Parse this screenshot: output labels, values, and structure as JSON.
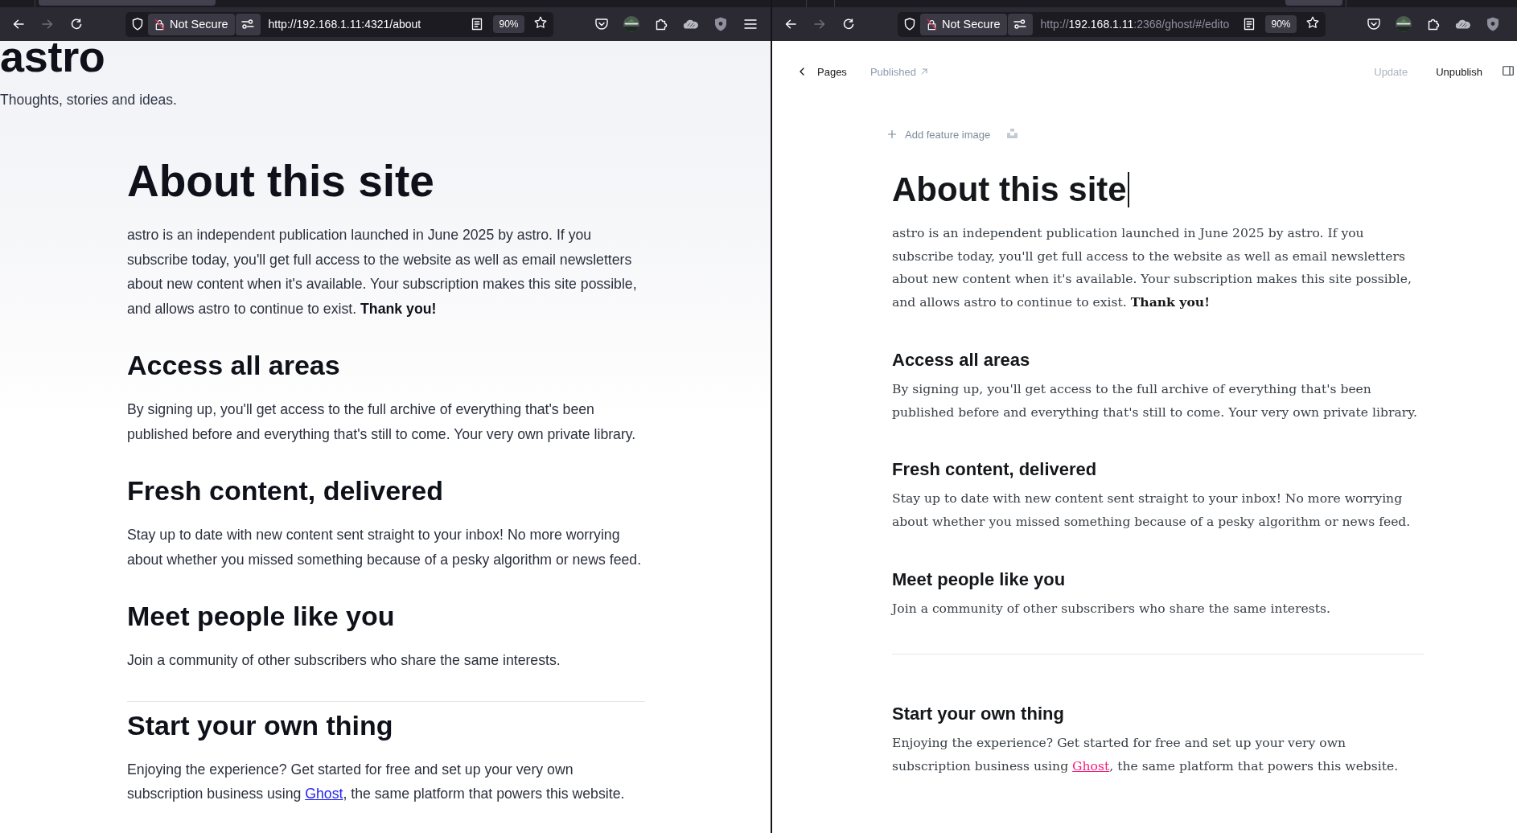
{
  "site_window": {
    "toolbar": {
      "back": {
        "disabled": false
      },
      "forward": {
        "disabled": true
      },
      "security_label": "Not Secure",
      "url": [
        {
          "text": "http://192.168.1.11:4321/about",
          "dim": false
        }
      ],
      "zoom": "90%",
      "menu": true
    },
    "site_title": "astro",
    "tagline": "Thoughts, stories and ideas.",
    "article": {
      "title": "About this site",
      "blocks": [
        {
          "kind": "paragraph",
          "parts": [
            {
              "text": "astro is an independent publication launched in June 2025 by astro. If you subscribe today, you'll get full access to the website as well as email newsletters about new content when it's available. Your subscription makes this site possible, and allows astro to continue to exist. **Thank you!**",
              "link": false
            }
          ]
        },
        {
          "kind": "heading",
          "text": "Access all areas"
        },
        {
          "kind": "paragraph",
          "parts": [
            {
              "text": "By signing up, you'll get access to the full archive of everything that's been published before and everything that's still to come. Your very own private library.",
              "link": false
            }
          ]
        },
        {
          "kind": "heading",
          "text": "Fresh content, delivered"
        },
        {
          "kind": "paragraph",
          "parts": [
            {
              "text": "Stay up to date with new content sent straight to your inbox! No more worrying about whether you missed something because of a pesky algorithm or news feed.",
              "link": false
            }
          ]
        },
        {
          "kind": "heading",
          "text": "Meet people like you"
        },
        {
          "kind": "paragraph",
          "parts": [
            {
              "text": "Join a community of other subscribers who share the same interests.",
              "link": false
            }
          ]
        },
        {
          "kind": "divider"
        },
        {
          "kind": "heading",
          "text": "Start your own thing"
        },
        {
          "kind": "paragraph",
          "parts": [
            {
              "text": "Enjoying the experience? Get started for free and set up your very own subscription business using ",
              "link": false
            },
            {
              "text": "Ghost",
              "link": true
            },
            {
              "text": ", the same platform that powers this website.",
              "link": false
            }
          ]
        }
      ]
    }
  },
  "editor_window": {
    "toolbar": {
      "back": {
        "disabled": false
      },
      "forward": {
        "disabled": true
      },
      "security_label": "Not Secure",
      "url": [
        {
          "text": "http://",
          "dim": true
        },
        {
          "text": "192.168.1.11",
          "dim": false
        },
        {
          "text": ":2368/ghost/#/edito",
          "dim": true
        }
      ],
      "zoom": "90%"
    },
    "header": {
      "back_label": "Pages",
      "status": "Published",
      "update": {
        "label": "Update",
        "disabled": true
      },
      "primary_action": "Unpublish"
    },
    "feature_image_label": "Add feature image",
    "article": {
      "title": "About this site",
      "caret": true,
      "blocks": [
        {
          "kind": "paragraph",
          "parts": [
            {
              "text": "astro is an independent publication launched in June 2025 by astro. If you subscribe today, you'll get full access to the website as well as email newsletters about new content when it's available. Your subscription makes this site possible, and allows astro to continue to exist. **Thank you!**",
              "link": false
            }
          ]
        },
        {
          "kind": "heading",
          "text": "Access all areas"
        },
        {
          "kind": "paragraph",
          "parts": [
            {
              "text": "By signing up, you'll get access to the full archive of everything that's been published before and everything that's still to come. Your very own private library.",
              "link": false
            }
          ]
        },
        {
          "kind": "heading",
          "text": "Fresh content, delivered"
        },
        {
          "kind": "paragraph",
          "parts": [
            {
              "text": "Stay up to date with new content sent straight to your inbox! No more worrying about whether you missed something because of a pesky algorithm or news feed.",
              "link": false
            }
          ]
        },
        {
          "kind": "heading",
          "text": "Meet people like you"
        },
        {
          "kind": "paragraph",
          "parts": [
            {
              "text": "Join a community of other subscribers who share the same interests.",
              "link": false
            }
          ]
        },
        {
          "kind": "divider"
        },
        {
          "kind": "heading",
          "text": "Start your own thing"
        },
        {
          "kind": "paragraph",
          "parts": [
            {
              "text": "Enjoying the experience? Get started for free and set up your very own subscription business using ",
              "link": false
            },
            {
              "text": "Ghost",
              "link": true
            },
            {
              "text": ", the same platform that powers this website.",
              "link": false
            }
          ]
        }
      ]
    }
  }
}
